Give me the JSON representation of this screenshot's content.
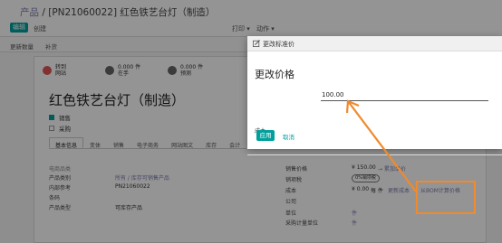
{
  "breadcrumb": {
    "parent": "产品",
    "separator": " / ",
    "current": "[PN21060022] 红色铁艺台灯（制造）"
  },
  "toolbar": {
    "edit": "编辑",
    "create": "创建",
    "print": "打印",
    "action": "动作"
  },
  "status_buttons": {
    "update_qty": "更新数量",
    "replenish": "补货"
  },
  "smart_buttons": [
    {
      "line1": "转到",
      "line2": "网站",
      "icon": "globe-icon",
      "color": "#e05555"
    },
    {
      "line1": "0.000 件",
      "line2": "在手",
      "icon": "cubes-icon",
      "color": "#666666"
    },
    {
      "line1": "0.000 件",
      "line2": "预测",
      "icon": "cubes-icon",
      "color": "#666666"
    }
  ],
  "product": {
    "name": "红色铁艺台灯（制造）",
    "can_be_sold": "销售",
    "can_be_purchased": "采购"
  },
  "tabs": [
    "基本信息",
    "变体",
    "销售",
    "电子商务",
    "网站图文",
    "库存",
    "会计"
  ],
  "general": {
    "section": "电商品类",
    "category_label": "产品类别",
    "category_value": "所有 / 库存可销售产品",
    "ref_label": "内部参考",
    "ref_value": "PN21060022",
    "barcode_label": "条码",
    "type_label": "产品类型",
    "type_value": "可库存产品"
  },
  "pricing": {
    "sales_price_label": "销售价格",
    "sales_price_value": "¥ 150.00",
    "extra_price_link": "→ 累加单价",
    "sales_tax_label": "销项税",
    "sales_tax_value": "0%销项税",
    "cost_label": "成本",
    "cost_value": "¥ 0.00",
    "cost_unit": "每 件",
    "update_cost_link": "更新成本",
    "bom_cost_link": "从BOM计算价格",
    "company_label": "公司",
    "uom_label": "单位",
    "uom_value": "件",
    "purchase_uom_label": "采购计量单位",
    "purchase_uom_value": "件"
  },
  "dialog": {
    "title": "更改标准价",
    "heading": "更改价格",
    "cost_label": "成本",
    "cost_value": "100.00",
    "apply": "应用",
    "cancel": "取消"
  },
  "colors": {
    "primary": "#00a09d",
    "link": "#7c7bad",
    "annotation": "#f08a2c"
  }
}
